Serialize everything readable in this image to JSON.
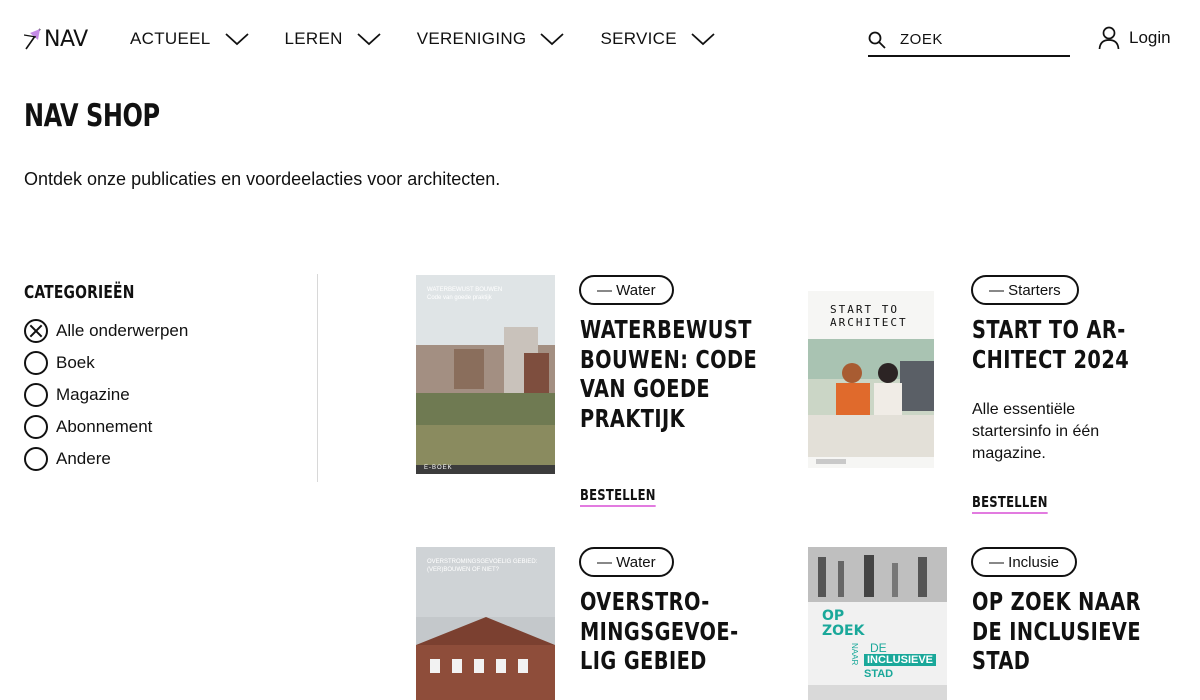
{
  "header": {
    "logo_text": "NAV",
    "nav": [
      {
        "label": "ACTUEEL"
      },
      {
        "label": "LEREN"
      },
      {
        "label": "VERENIGING"
      },
      {
        "label": "SERVICE"
      }
    ],
    "search": {
      "placeholder": "ZOEK",
      "value": ""
    },
    "login_label": "Login"
  },
  "page": {
    "title": "NAV SHOP",
    "subtitle": "Ontdek onze publicaties en voordeelacties voor architecten."
  },
  "sidebar": {
    "title": "CATEGORIEËN",
    "items": [
      {
        "label": "Alle onderwerpen",
        "checked": true
      },
      {
        "label": "Boek",
        "checked": false
      },
      {
        "label": "Magazine",
        "checked": false
      },
      {
        "label": "Abonnement",
        "checked": false
      },
      {
        "label": "Andere",
        "checked": false
      }
    ]
  },
  "products": [
    {
      "tag": "— Water",
      "title": "WATERBEWUST BOUWEN: CODE VAN GOEDE PRAKTIJK",
      "description": "",
      "cta": "BESTELLEN",
      "cover_title": "WATERBEWUST BOUWEN",
      "cover_subtitle": "Code van goede praktijk",
      "cover_footer": "E-BOEK"
    },
    {
      "tag": "— Starters",
      "title": "START TO AR-CHITECT 2024",
      "description": "Alle essentiële startersinfo in één magazine.",
      "cta": "BESTELLEN",
      "cover_title": "START TO ARCHITECT"
    },
    {
      "tag": "— Water",
      "title": "OVERSTRO-MINGSGEVOE-LIG GEBIED",
      "description": "",
      "cta": "",
      "cover_title": "OVERSTROMINGSGEVOELIG GEBIED: (VER)BOUWEN OF NIET?"
    },
    {
      "tag": "— Inclusie",
      "title": "OP ZOEK NAAR DE INCLUSIEVE STAD",
      "description": "",
      "cta": "",
      "cover_words": [
        "OP",
        "ZOEK",
        "DE",
        "NAAR",
        "INCLUSIEVE",
        "STAD"
      ]
    }
  ],
  "colors": {
    "accent": "#e27be0",
    "logo_arrow": "#c58be6",
    "text": "#111111",
    "inclusie_green": "#1aa89a"
  }
}
